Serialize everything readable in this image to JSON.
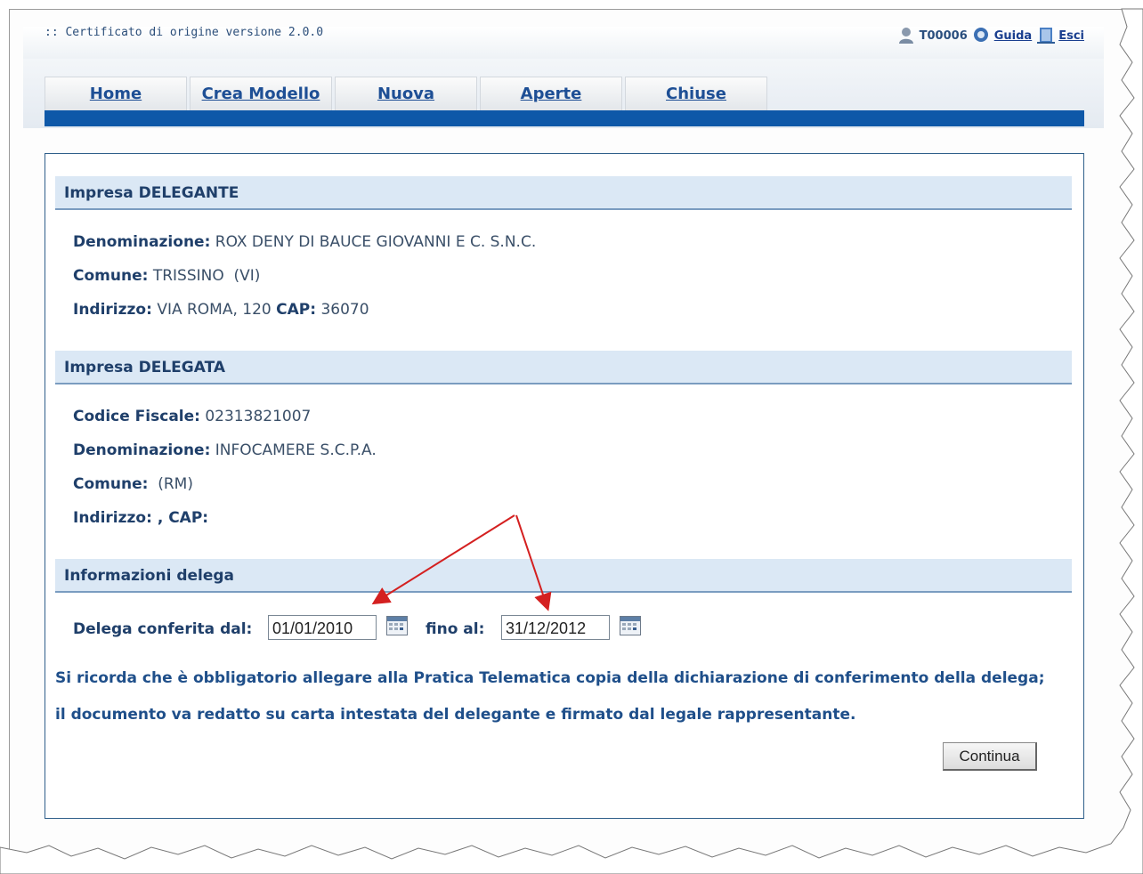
{
  "app": {
    "title": ":: Certificato di origine versione 2.0.0"
  },
  "userbar": {
    "user_id": "T00006",
    "help": "Guida",
    "exit": "Esci"
  },
  "tabs": [
    {
      "label": "Home"
    },
    {
      "label": "Crea Modello"
    },
    {
      "label": "Nuova"
    },
    {
      "label": "Aperte"
    },
    {
      "label": "Chiuse"
    }
  ],
  "delegante": {
    "heading": "Impresa DELEGANTE",
    "denominazione_label": "Denominazione:",
    "denominazione": "ROX DENY DI BAUCE GIOVANNI E C. S.N.C.",
    "comune_label": "Comune:",
    "comune": "TRISSINO  (VI)",
    "indirizzo_label": "Indirizzo:",
    "indirizzo": "VIA ROMA, 120",
    "cap_label": "CAP:",
    "cap": "36070"
  },
  "delegata": {
    "heading": "Impresa DELEGATA",
    "codice_fiscale_label": "Codice Fiscale:",
    "codice_fiscale": "02313821007",
    "denominazione_label": "Denominazione:",
    "denominazione": "INFOCAMERE S.C.P.A.",
    "comune_label": "Comune:",
    "comune": " (RM)",
    "indirizzo_label": "Indirizzo: , CAP:"
  },
  "delega": {
    "heading": "Informazioni delega",
    "from_label": "Delega conferita dal:",
    "from_value": "01/01/2010",
    "to_label": "fino al:",
    "to_value": "31/12/2012"
  },
  "notice": {
    "line1": "Si ricorda che è obbligatorio allegare alla Pratica Telematica copia della dichiarazione di conferimento della delega;",
    "line2": "il documento va redatto su carta intestata del delegante e firmato dal legale rappresentante."
  },
  "actions": {
    "continue": "Continua"
  },
  "colors": {
    "nav_bar": "#0e58a8",
    "section_bg": "#dbe8f5",
    "annotation_arrow": "#d42020"
  }
}
